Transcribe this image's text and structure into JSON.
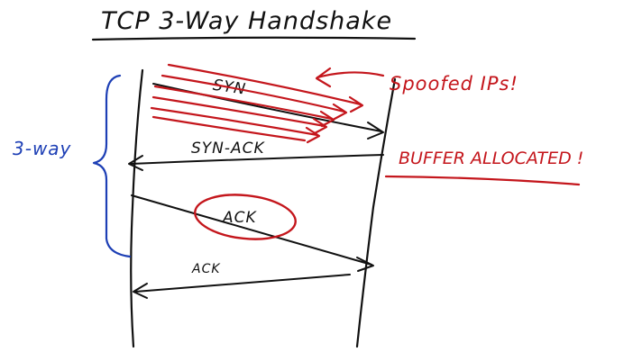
{
  "title": "TCP 3-Way Handshake",
  "side_label": "3-way",
  "messages": {
    "syn": "SYN",
    "syn_ack": "SYN-ACK",
    "ack_circled": "ACK",
    "ack_bottom": "ACK"
  },
  "annotations": {
    "spoofed": "Spoofed IPs!",
    "buffer": "BUFFER ALLOCATED !"
  },
  "colors": {
    "ink": "#111111",
    "red": "#c4161c",
    "blue": "#1d3fb5"
  }
}
